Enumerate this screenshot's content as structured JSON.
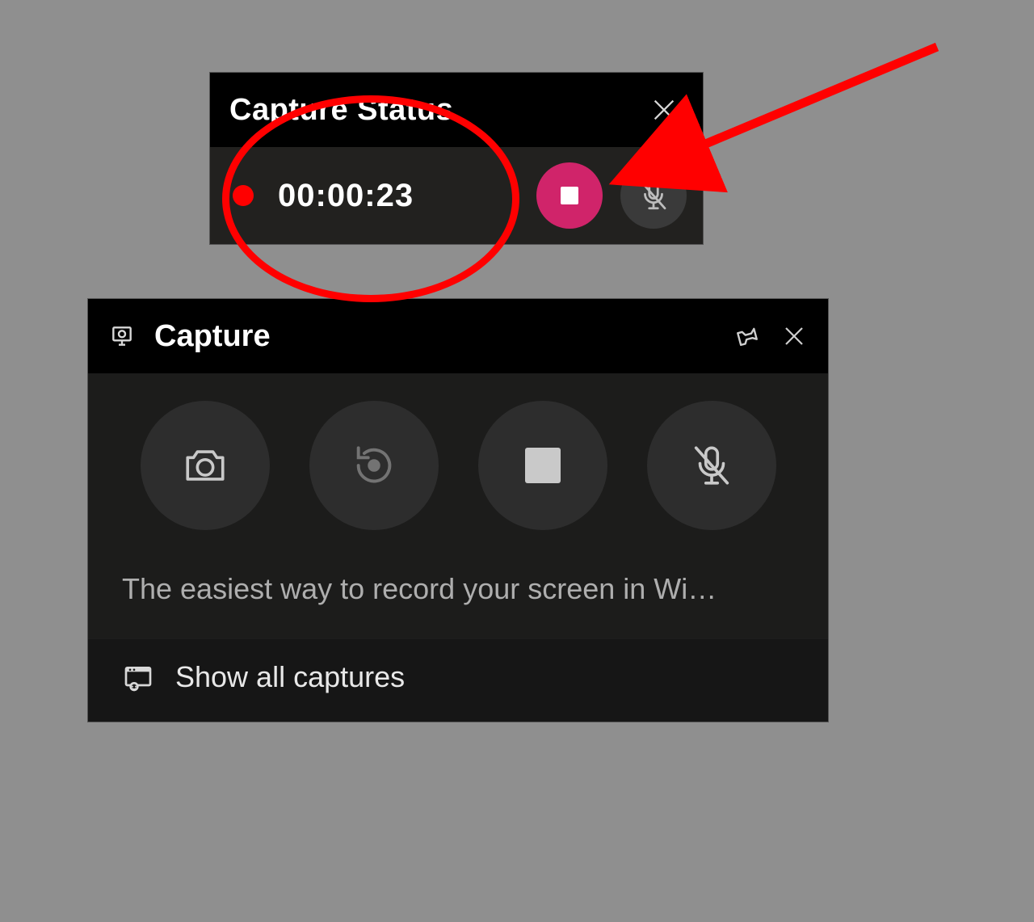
{
  "status_panel": {
    "title": "Capture Status",
    "time": "00:00:23",
    "stop_icon": "stop-icon",
    "mic_icon": "mic-muted-icon"
  },
  "capture_panel": {
    "title": "Capture",
    "buttons": {
      "screenshot": "camera-icon",
      "record_last": "record-last-icon",
      "stop": "stop-icon",
      "mic": "mic-muted-icon"
    },
    "caption": "The easiest way to record your screen in Wi…",
    "footer_label": "Show all captures"
  },
  "colors": {
    "accent_pink": "#d0246a",
    "record_red": "#ff0000",
    "panel_dark": "#1a1a1a",
    "header_black": "#000000"
  },
  "annotation": {
    "type": "arrow-ellipse",
    "target": "mic-toggle-button"
  }
}
